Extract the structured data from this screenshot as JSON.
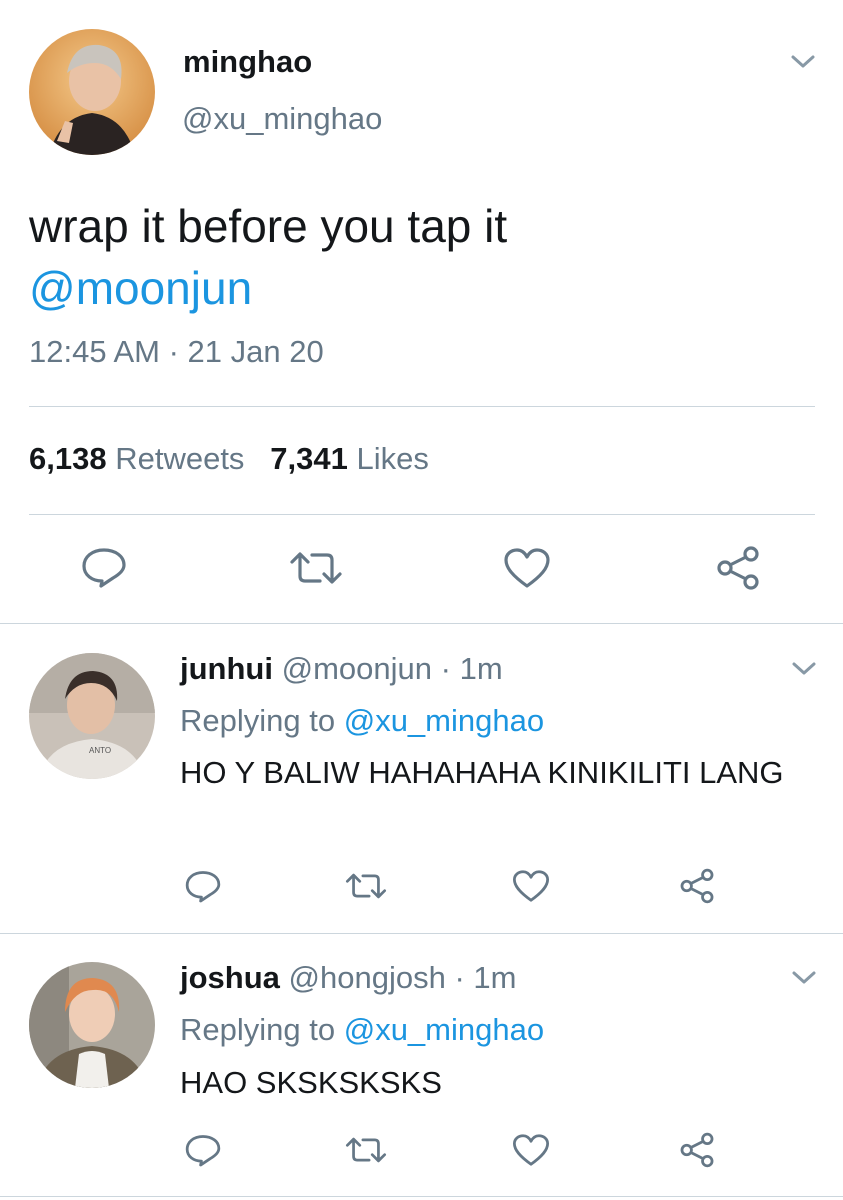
{
  "main_tweet": {
    "display_name": "minghao",
    "handle": "@xu_minghao",
    "text": "wrap it before you tap it",
    "mention": "@moonjun",
    "timestamp": "12:45 AM · 21 Jan 20",
    "retweets_count": "6,138",
    "retweets_label": "Retweets",
    "likes_count": "7,341",
    "likes_label": "Likes",
    "avatar_icon": "user-avatar-photo"
  },
  "replies": [
    {
      "display_name": "junhui",
      "handle": "@moonjun",
      "separator": "·",
      "time": "1m",
      "replying_prefix": "Replying to",
      "replying_to": "@xu_minghao",
      "text": "HO Y BALIW HAHAHAHA KINIKILITI LANG",
      "avatar_icon": "user-avatar-photo"
    },
    {
      "display_name": "joshua",
      "handle": "@hongjosh",
      "separator": "·",
      "time": "1m",
      "replying_prefix": "Replying to",
      "replying_to": "@xu_minghao",
      "text": "HAO SKSKSKSKS",
      "avatar_icon": "user-avatar-photo"
    }
  ],
  "icons": {
    "reply": "reply-icon",
    "retweet": "retweet-icon",
    "like": "heart-icon",
    "share": "share-icon",
    "menu": "chevron-down-icon"
  },
  "colors": {
    "link": "#1b95e0",
    "secondary_text": "#657786",
    "primary_text": "#14171a",
    "divider": "#ccd6dd"
  }
}
